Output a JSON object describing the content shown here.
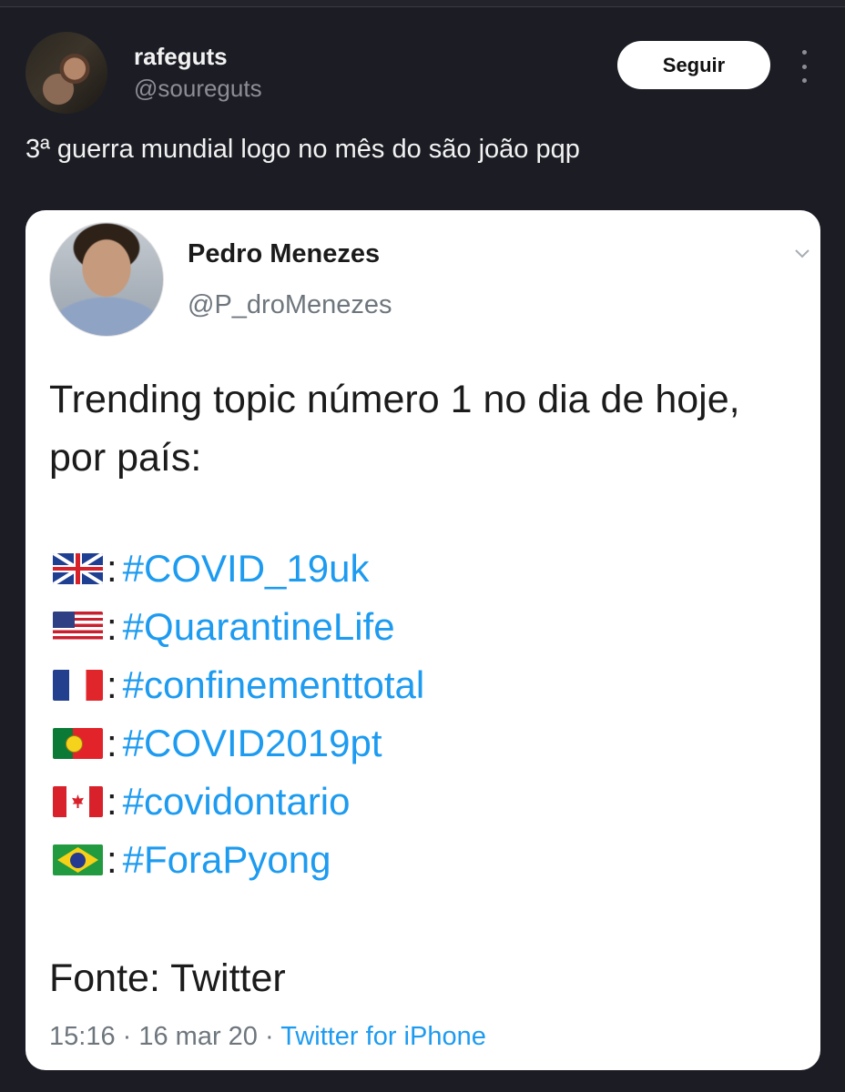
{
  "post": {
    "author_name": "rafeguts",
    "author_handle": "@soureguts",
    "follow_label": "Seguir",
    "text": "3ª guerra mundial logo no mês do são joão pqp"
  },
  "embedded": {
    "author_name": "Pedro Menezes",
    "author_handle": "@P_droMenezes",
    "intro": "Trending topic número 1 no dia de hoje, por país:",
    "trends": [
      {
        "flag": "uk-flag",
        "sep": ":",
        "tag": "#COVID_19uk"
      },
      {
        "flag": "us-flag",
        "sep": ":",
        "tag": "#QuarantineLife"
      },
      {
        "flag": "france-flag",
        "sep": ":",
        "tag": "#confinementtotal"
      },
      {
        "flag": "portugal-flag",
        "sep": ":",
        "tag": "#COVID2019pt"
      },
      {
        "flag": "canada-flag",
        "sep": ":",
        "tag": "#covidontario"
      },
      {
        "flag": "brazil-flag",
        "sep": ":",
        "tag": "#ForaPyong"
      }
    ],
    "source": "Fonte: Twitter",
    "time": "15:16",
    "date": "16 mar 20",
    "via": "Twitter for iPhone"
  },
  "colors": {
    "background": "#1c1d24",
    "card": "#ffffff",
    "link_blue": "#1d9bf0",
    "muted": "#8d8e95"
  }
}
